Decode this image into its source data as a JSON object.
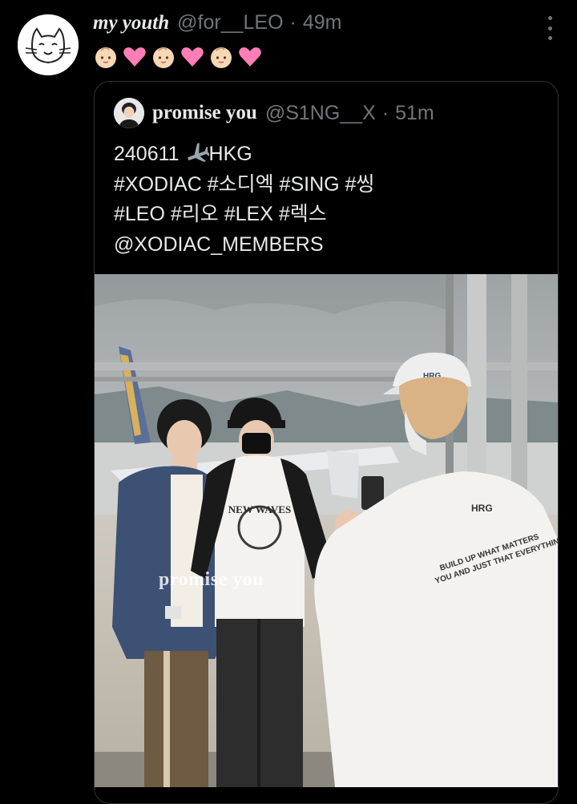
{
  "tweet": {
    "display_name": "my youth",
    "handle": "@for__LEO",
    "separator": "·",
    "time": "49m",
    "text_emojis": [
      "baby-face",
      "pink-heart",
      "baby-face",
      "pink-heart",
      "baby-face",
      "pink-heart"
    ]
  },
  "quoted": {
    "display_name": "promise you",
    "handle": "@S1NG__X",
    "separator": "·",
    "time": "51m",
    "line1_prefix": "240611",
    "line1_suffix": "HKG",
    "line2": "#XODIAC #소디엑 #SING #씽",
    "line3": "#LEO #리오 #LEX #렉스",
    "line4": "@XODIAC_MEMBERS",
    "photo": {
      "watermark": "promise you",
      "shirt_graphic_text": "NEW WAVES",
      "shirt_back_text_1": "BUILD UP WHAT MATTERS",
      "shirt_back_text_2": "YOU AND JUST THAT EVERYTHING",
      "cap_logo": "HRG"
    }
  },
  "colors": {
    "background": "#000000",
    "text_primary": "#e7e9ea",
    "text_secondary": "#71767b",
    "border": "#2f3336",
    "heart": "#ff7eb6"
  }
}
